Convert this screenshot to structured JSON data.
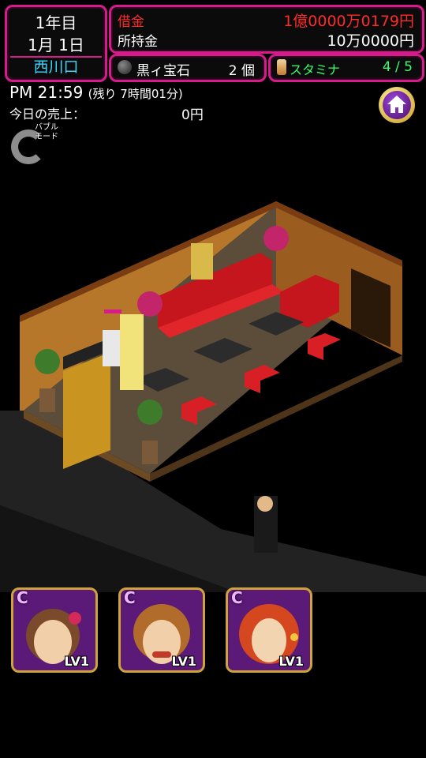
{
  "status": {
    "year": "1年目",
    "date": "1月 1日",
    "location": "西川口",
    "debt_label": "借金",
    "debt_value": "1億0000万0179円",
    "cash_label": "所持金",
    "cash_value": "10万0000円",
    "gem_label": "黒ィ宝石",
    "gem_count": "2 個",
    "stamina_label": "スタミナ",
    "stamina_value": "4 / 5"
  },
  "time": {
    "clock": "PM 21:59",
    "remaining": "(残り 7時間01分)",
    "sales_label": "今日の売上：",
    "sales_value": "0円"
  },
  "bubble_mode": {
    "label": "バブル\nモード"
  },
  "hostesses": [
    {
      "badge": "C",
      "level": "LV1"
    },
    {
      "badge": "C",
      "level": "LV1"
    },
    {
      "badge": "C",
      "level": "LV1"
    }
  ],
  "colors": {
    "frame": "#d81b8c",
    "debt": "#ff2a2a",
    "location": "#38d8ff",
    "stamina": "#38ff6a",
    "card_gold": "#cda33a"
  },
  "icons": {
    "home": "home-icon",
    "gem": "black-gem-icon",
    "stamina": "stamina-drink-icon",
    "bubble": "bubble-mode-icon"
  }
}
